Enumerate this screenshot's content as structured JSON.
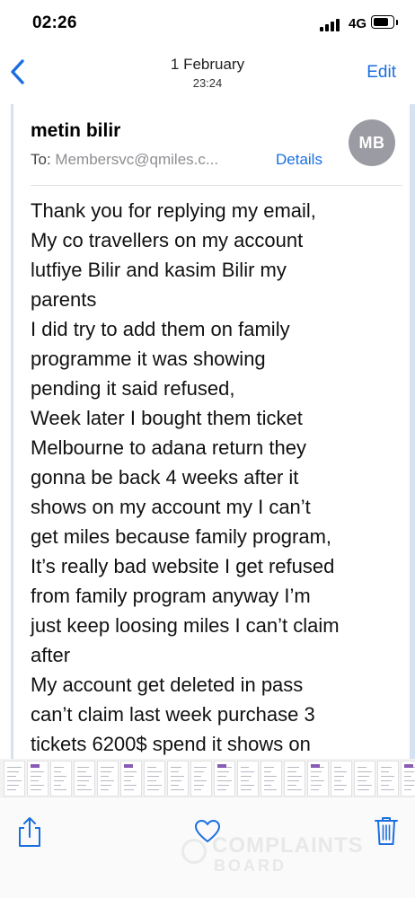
{
  "status_bar": {
    "time": "02:26",
    "network": "4G",
    "battery_level": 0.85
  },
  "nav": {
    "date": "1 February",
    "time": "23:24",
    "edit_label": "Edit",
    "back_icon": "chevron-left-icon"
  },
  "message": {
    "sender": "metin bilir",
    "to_label": "To:",
    "to_address": "Membersvc@qmiles.c...",
    "details_label": "Details",
    "avatar_initials": "MB",
    "body_lines": [
      "Thank you for replying my email,",
      "My co travellers on my account",
      "lutfiye Bilir and kasim Bilir my",
      "parents",
      "I did try to add them on family",
      "programme it was showing",
      "pending it said refused,",
      "Week later I bought them ticket",
      "Melbourne to adana return they",
      "gonna be back 4 weeks after it",
      "shows on my account my I can’t",
      "get miles because family program,",
      "It’s really bad website I get refused",
      "from family program anyway I’m",
      "just keep loosing miles I can’t claim",
      "after",
      "My account get deleted in pass",
      "can’t claim last week purchase 3",
      "tickets 6200$ spend it shows on"
    ]
  },
  "toolbar": {
    "share_icon": "share-icon",
    "reply_icon": "heart-icon",
    "trash_icon": "trash-icon"
  },
  "watermark": {
    "line1": "COMPLAINTS",
    "line2": "BOARD"
  },
  "colors": {
    "accent": "#1a6fe0",
    "avatar_bg": "#9b9ca3",
    "quote_rule": "#d4e2f1"
  }
}
